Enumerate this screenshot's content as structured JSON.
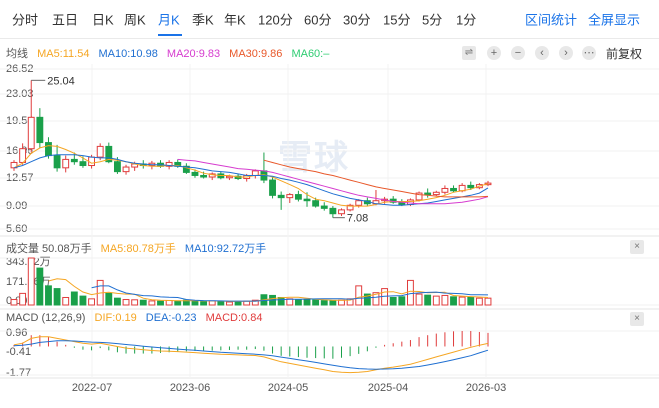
{
  "tabs": [
    {
      "label": "分时",
      "active": false
    },
    {
      "label": "五日",
      "active": false
    },
    {
      "label": "日K",
      "active": false
    },
    {
      "label": "周K",
      "active": false
    },
    {
      "label": "月K",
      "active": true
    },
    {
      "label": "季K",
      "active": false
    },
    {
      "label": "年K",
      "active": false
    },
    {
      "label": "120分",
      "active": false
    },
    {
      "label": "60分",
      "active": false
    },
    {
      "label": "30分",
      "active": false
    },
    {
      "label": "15分",
      "active": false
    },
    {
      "label": "5分",
      "active": false
    },
    {
      "label": "1分",
      "active": false
    }
  ],
  "toolbar": {
    "range_stats": "区间统计",
    "fullscreen": "全屏显示",
    "adjust": "前复权"
  },
  "colors": {
    "accent": "#1a73e8",
    "up": "#e03c3c",
    "down": "#1aa04a",
    "ma5": "#f5a623",
    "ma10": "#1f6fd1",
    "ma20": "#d63ccf",
    "ma30": "#e8582a",
    "ma60": "#2ecc71"
  },
  "price": {
    "legend": {
      "label": "均线",
      "ma5": "MA5:11.54",
      "ma10": "MA10:10.98",
      "ma20": "MA20:9.83",
      "ma30": "MA30:9.86",
      "ma60": "MA60:–"
    },
    "y_ticks": [
      "26.52",
      "23.03",
      "19.54",
      "16.06",
      "12.57",
      "9.09",
      "5.60"
    ],
    "high_label": "25.04",
    "low_label": "7.08"
  },
  "volume": {
    "legend": {
      "label": "成交量 50.08万手",
      "ma5": "MA5:80.78万手",
      "ma10": "MA10:92.72万手"
    },
    "y_ticks": [
      "343.92万",
      "171.96万",
      "0.00"
    ]
  },
  "macd": {
    "legend": {
      "label": "MACD (12,26,9)",
      "dif": "DIF:0.19",
      "dea": "DEA:-0.23",
      "macd": "MACD:0.84"
    },
    "y_ticks": [
      "0.96",
      "-0.41",
      "-1.77"
    ]
  },
  "x_ticks": [
    "2022-07",
    "2023-06",
    "2024-05",
    "2025-04",
    "2026-03"
  ],
  "watermark": "雪球",
  "chart_data": {
    "type": "candlestick",
    "interval": "monthly",
    "adjustment": "前复权",
    "x_ticks": [
      "2022-07",
      "2023-06",
      "2024-05",
      "2025-04",
      "2026-03"
    ],
    "price_range": [
      5.6,
      26.52
    ],
    "volume_range": [
      0,
      343.92
    ],
    "volume_unit": "万手",
    "macd_range": [
      -1.77,
      0.96
    ],
    "candles": [
      {
        "o": 13.6,
        "h": 14.6,
        "l": 13.2,
        "c": 14.3
      },
      {
        "o": 14.3,
        "h": 16.8,
        "l": 14.0,
        "c": 16.1
      },
      {
        "o": 16.1,
        "h": 25.04,
        "l": 15.6,
        "c": 20.2
      },
      {
        "o": 20.2,
        "h": 21.4,
        "l": 16.2,
        "c": 16.9
      },
      {
        "o": 16.9,
        "h": 17.6,
        "l": 14.8,
        "c": 15.2
      },
      {
        "o": 15.2,
        "h": 16.6,
        "l": 13.1,
        "c": 13.6
      },
      {
        "o": 13.6,
        "h": 15.2,
        "l": 13.0,
        "c": 14.7
      },
      {
        "o": 14.7,
        "h": 15.6,
        "l": 14.0,
        "c": 14.4
      },
      {
        "o": 14.4,
        "h": 15.1,
        "l": 13.6,
        "c": 13.9
      },
      {
        "o": 13.9,
        "h": 15.3,
        "l": 13.5,
        "c": 15.0
      },
      {
        "o": 15.0,
        "h": 16.8,
        "l": 14.6,
        "c": 16.4
      },
      {
        "o": 16.4,
        "h": 16.9,
        "l": 14.2,
        "c": 14.4
      },
      {
        "o": 14.4,
        "h": 15.0,
        "l": 12.8,
        "c": 13.1
      },
      {
        "o": 13.1,
        "h": 14.0,
        "l": 12.7,
        "c": 13.7
      },
      {
        "o": 13.7,
        "h": 14.4,
        "l": 13.2,
        "c": 14.1
      },
      {
        "o": 14.1,
        "h": 14.6,
        "l": 13.5,
        "c": 13.9
      },
      {
        "o": 13.9,
        "h": 14.5,
        "l": 13.4,
        "c": 14.2
      },
      {
        "o": 14.2,
        "h": 14.6,
        "l": 13.6,
        "c": 13.8
      },
      {
        "o": 13.8,
        "h": 14.6,
        "l": 13.4,
        "c": 14.3
      },
      {
        "o": 14.3,
        "h": 14.7,
        "l": 13.6,
        "c": 13.8
      },
      {
        "o": 13.8,
        "h": 14.2,
        "l": 12.8,
        "c": 13.0
      },
      {
        "o": 13.0,
        "h": 13.4,
        "l": 12.3,
        "c": 12.6
      },
      {
        "o": 12.6,
        "h": 13.1,
        "l": 12.2,
        "c": 12.4
      },
      {
        "o": 12.4,
        "h": 13.0,
        "l": 12.0,
        "c": 12.8
      },
      {
        "o": 12.8,
        "h": 13.1,
        "l": 12.1,
        "c": 12.3
      },
      {
        "o": 12.3,
        "h": 12.7,
        "l": 12.0,
        "c": 12.5
      },
      {
        "o": 12.5,
        "h": 12.8,
        "l": 12.0,
        "c": 12.2
      },
      {
        "o": 12.2,
        "h": 12.8,
        "l": 11.8,
        "c": 12.6
      },
      {
        "o": 12.6,
        "h": 13.4,
        "l": 12.2,
        "c": 13.2
      },
      {
        "o": 13.2,
        "h": 15.6,
        "l": 11.6,
        "c": 12.0
      },
      {
        "o": 12.0,
        "h": 12.4,
        "l": 9.6,
        "c": 10.0
      },
      {
        "o": 10.0,
        "h": 10.5,
        "l": 8.1,
        "c": 9.7
      },
      {
        "o": 9.7,
        "h": 10.3,
        "l": 9.0,
        "c": 10.1
      },
      {
        "o": 10.1,
        "h": 10.6,
        "l": 9.2,
        "c": 9.5
      },
      {
        "o": 9.5,
        "h": 10.4,
        "l": 8.5,
        "c": 9.3
      },
      {
        "o": 9.3,
        "h": 9.7,
        "l": 8.4,
        "c": 8.6
      },
      {
        "o": 8.6,
        "h": 9.1,
        "l": 8.0,
        "c": 8.3
      },
      {
        "o": 8.3,
        "h": 8.6,
        "l": 7.08,
        "c": 7.6
      },
      {
        "o": 7.6,
        "h": 8.3,
        "l": 7.3,
        "c": 8.1
      },
      {
        "o": 8.1,
        "h": 8.9,
        "l": 7.9,
        "c": 8.7
      },
      {
        "o": 8.7,
        "h": 9.5,
        "l": 8.4,
        "c": 9.3
      },
      {
        "o": 9.3,
        "h": 9.7,
        "l": 8.6,
        "c": 8.9
      },
      {
        "o": 8.9,
        "h": 10.7,
        "l": 8.7,
        "c": 9.3
      },
      {
        "o": 9.3,
        "h": 9.8,
        "l": 8.9,
        "c": 9.5
      },
      {
        "o": 9.5,
        "h": 9.9,
        "l": 8.9,
        "c": 9.1
      },
      {
        "o": 9.1,
        "h": 9.5,
        "l": 8.6,
        "c": 8.8
      },
      {
        "o": 8.8,
        "h": 9.6,
        "l": 8.6,
        "c": 9.4
      },
      {
        "o": 9.4,
        "h": 10.5,
        "l": 9.2,
        "c": 10.3
      },
      {
        "o": 10.3,
        "h": 10.9,
        "l": 9.7,
        "c": 10.1
      },
      {
        "o": 10.1,
        "h": 10.6,
        "l": 9.9,
        "c": 10.4
      },
      {
        "o": 10.4,
        "h": 11.3,
        "l": 10.1,
        "c": 10.9
      },
      {
        "o": 10.9,
        "h": 11.3,
        "l": 10.4,
        "c": 10.6
      },
      {
        "o": 10.6,
        "h": 11.6,
        "l": 10.4,
        "c": 11.3
      },
      {
        "o": 11.3,
        "h": 11.8,
        "l": 10.7,
        "c": 11.0
      },
      {
        "o": 11.0,
        "h": 11.6,
        "l": 10.8,
        "c": 11.4
      },
      {
        "o": 11.4,
        "h": 11.9,
        "l": 11.2,
        "c": 11.6
      }
    ],
    "volume": [
      40,
      85,
      343.92,
      270,
      140,
      120,
      55,
      95,
      65,
      45,
      180,
      85,
      50,
      40,
      38,
      35,
      30,
      28,
      33,
      30,
      35,
      28,
      25,
      30,
      28,
      22,
      26,
      28,
      35,
      75,
      70,
      55,
      45,
      40,
      38,
      36,
      32,
      30,
      35,
      45,
      140,
      80,
      90,
      120,
      55,
      60,
      180,
      80,
      72,
      65,
      70,
      60,
      58,
      55,
      50,
      50.08
    ],
    "ma5": [
      13.6,
      14.2,
      15.5,
      16.2,
      16.5,
      16.4,
      16.0,
      15.5,
      14.9,
      14.2,
      14.4,
      14.7,
      14.6,
      14.4,
      14.1,
      13.9,
      13.8,
      13.8,
      13.9,
      13.9,
      13.6,
      13.3,
      12.9,
      12.7,
      12.6,
      12.6,
      12.4,
      12.4,
      12.6,
      12.7,
      12.4,
      11.9,
      11.4,
      10.9,
      10.1,
      9.5,
      9.3,
      9.0,
      8.7,
      8.6,
      8.6,
      8.6,
      8.8,
      9.1,
      9.2,
      9.2,
      9.2,
      9.3,
      9.5,
      9.7,
      10.0,
      10.4,
      10.6,
      10.8,
      11.2,
      11.54
    ],
    "ma10": [
      13.6,
      13.9,
      14.4,
      14.9,
      15.2,
      15.3,
      15.3,
      15.3,
      15.2,
      15.0,
      14.9,
      14.9,
      14.7,
      14.4,
      14.2,
      14.1,
      14.0,
      14.0,
      13.9,
      13.8,
      13.7,
      13.6,
      13.4,
      13.2,
      13.1,
      13.0,
      12.8,
      12.6,
      12.6,
      12.6,
      12.5,
      12.2,
      12.0,
      11.7,
      11.4,
      11.0,
      10.6,
      10.2,
      9.9,
      9.6,
      9.4,
      9.2,
      8.9,
      8.8,
      8.7,
      8.7,
      8.8,
      8.9,
      9.0,
      9.2,
      9.4,
      9.6,
      9.8,
      10.0,
      10.3,
      10.98
    ],
    "ma20": [
      null,
      null,
      null,
      null,
      null,
      null,
      null,
      null,
      null,
      null,
      null,
      null,
      null,
      null,
      null,
      null,
      null,
      null,
      null,
      14.7,
      14.6,
      14.5,
      14.3,
      14.1,
      13.9,
      13.7,
      13.5,
      13.4,
      13.3,
      13.2,
      13.0,
      12.7,
      12.4,
      12.1,
      11.8,
      11.5,
      11.2,
      10.9,
      10.6,
      10.3,
      10.0,
      9.8,
      9.6,
      9.4,
      9.2,
      9.1,
      9.0,
      8.9,
      8.9,
      8.9,
      8.9,
      9.0,
      9.1,
      9.3,
      9.5,
      9.83
    ],
    "ma30": [
      null,
      null,
      null,
      null,
      null,
      null,
      null,
      null,
      null,
      null,
      null,
      null,
      null,
      null,
      null,
      null,
      null,
      null,
      null,
      null,
      null,
      null,
      null,
      null,
      null,
      null,
      null,
      null,
      null,
      14.6,
      14.3,
      14.0,
      13.7,
      13.5,
      13.3,
      13.1,
      12.8,
      12.6,
      12.3,
      12.0,
      11.7,
      11.4,
      11.1,
      10.9,
      10.7,
      10.5,
      10.3,
      10.1,
      10.0,
      9.9,
      9.8,
      9.8,
      9.8,
      9.8,
      9.8,
      9.86
    ],
    "macd_dif": [
      0.1,
      0.2,
      0.5,
      0.6,
      0.6,
      0.5,
      0.4,
      0.3,
      0.2,
      0.15,
      0.2,
      0.1,
      0.0,
      -0.1,
      -0.15,
      -0.2,
      -0.25,
      -0.28,
      -0.3,
      -0.32,
      -0.35,
      -0.38,
      -0.42,
      -0.45,
      -0.48,
      -0.5,
      -0.52,
      -0.55,
      -0.56,
      -0.65,
      -0.8,
      -0.95,
      -1.05,
      -1.15,
      -1.25,
      -1.35,
      -1.45,
      -1.55,
      -1.6,
      -1.62,
      -1.6,
      -1.55,
      -1.45,
      -1.35,
      -1.28,
      -1.2,
      -1.1,
      -0.95,
      -0.8,
      -0.65,
      -0.5,
      -0.35,
      -0.2,
      -0.05,
      0.08,
      0.19
    ],
    "macd_dea": [
      0.05,
      0.08,
      0.15,
      0.25,
      0.3,
      0.35,
      0.35,
      0.34,
      0.3,
      0.27,
      0.25,
      0.22,
      0.18,
      0.12,
      0.07,
      0.02,
      -0.03,
      -0.08,
      -0.12,
      -0.16,
      -0.2,
      -0.24,
      -0.28,
      -0.32,
      -0.36,
      -0.39,
      -0.42,
      -0.45,
      -0.48,
      -0.52,
      -0.58,
      -0.66,
      -0.74,
      -0.82,
      -0.9,
      -0.99,
      -1.08,
      -1.17,
      -1.25,
      -1.32,
      -1.37,
      -1.4,
      -1.41,
      -1.4,
      -1.38,
      -1.35,
      -1.3,
      -1.24,
      -1.15,
      -1.05,
      -0.94,
      -0.82,
      -0.7,
      -0.57,
      -0.4,
      -0.23
    ],
    "macd_hist": [
      0.1,
      0.24,
      0.7,
      0.7,
      0.6,
      0.3,
      0.1,
      -0.08,
      -0.2,
      -0.24,
      -0.1,
      -0.24,
      -0.36,
      -0.44,
      -0.44,
      -0.44,
      -0.44,
      -0.4,
      -0.36,
      -0.32,
      -0.3,
      -0.28,
      -0.28,
      -0.26,
      -0.24,
      -0.22,
      -0.2,
      -0.2,
      -0.16,
      -0.26,
      -0.44,
      -0.58,
      -0.62,
      -0.66,
      -0.7,
      -0.72,
      -0.74,
      -0.76,
      -0.7,
      -0.6,
      -0.46,
      -0.3,
      -0.08,
      0.1,
      0.2,
      0.3,
      0.4,
      0.58,
      0.7,
      0.8,
      0.88,
      0.94,
      0.96,
      0.96,
      0.9,
      0.84
    ]
  }
}
